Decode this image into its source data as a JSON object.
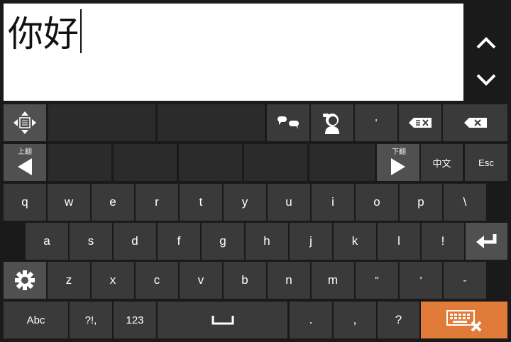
{
  "input": {
    "text": "你好"
  },
  "side_nav": {
    "up_icon": "chevron-up-icon",
    "down_icon": "chevron-down-icon"
  },
  "row1": {
    "move_icon": "move-handle-icon",
    "chat_icon": "chat-bubbles-icon",
    "voice_icon": "person-speaking-icon",
    "apostrophe": "'",
    "clear_icon": "clear-all-icon",
    "backspace_icon": "backspace-icon"
  },
  "row2": {
    "page_up": "上翻",
    "page_down": "下翻",
    "lang": "中文",
    "esc": "Esc"
  },
  "row3": [
    "q",
    "w",
    "e",
    "r",
    "t",
    "y",
    "u",
    "i",
    "o",
    "p",
    "\\"
  ],
  "row4": [
    "a",
    "s",
    "d",
    "f",
    "g",
    "h",
    "j",
    "k",
    "l",
    "!"
  ],
  "row5": [
    "z",
    "x",
    "c",
    "v",
    "b",
    "n",
    "m",
    "\"",
    "'",
    "-"
  ],
  "row6": {
    "abc": "Abc",
    "punct": "?!,",
    "num": "123",
    "period": ".",
    "comma": ",",
    "question": "?"
  },
  "colors": {
    "key": "#3a3a3a",
    "key_dark": "#2b2b2b",
    "key_grey": "#505050",
    "accent": "#e07b39",
    "background": "#1a1a1a"
  }
}
